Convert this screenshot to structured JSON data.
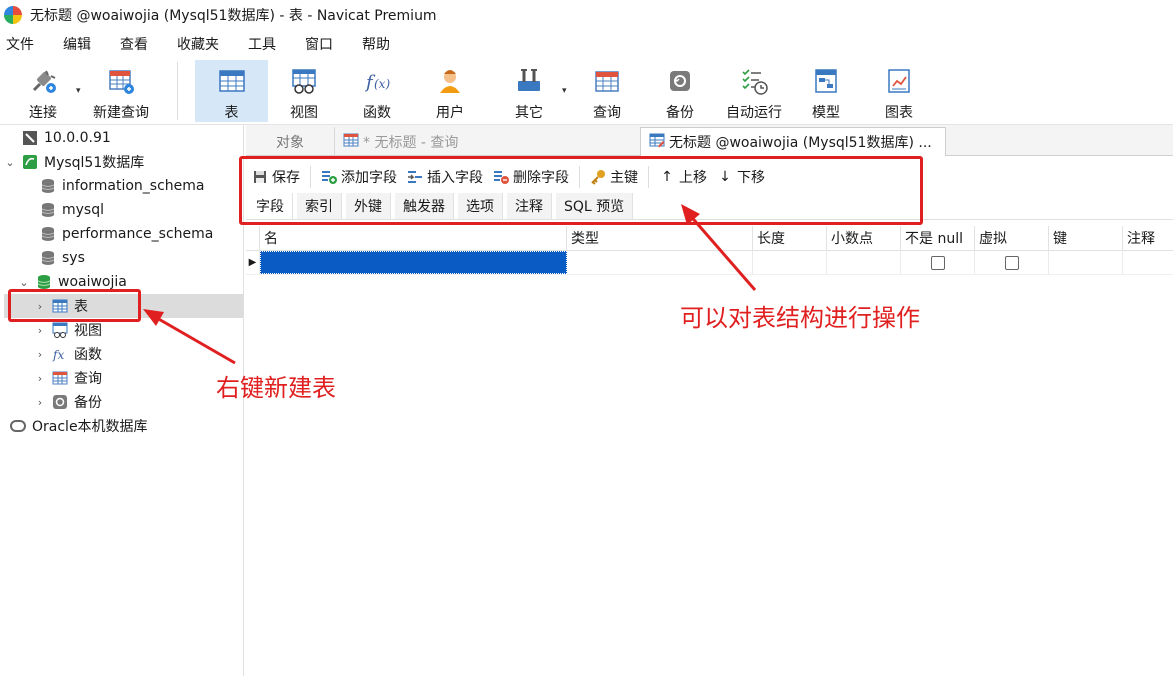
{
  "window": {
    "title": "无标题 @woaiwojia (Mysql51数据库) - 表 - Navicat Premium"
  },
  "menu": [
    "文件",
    "编辑",
    "查看",
    "收藏夹",
    "工具",
    "窗口",
    "帮助"
  ],
  "toolbar": {
    "connect": "连接",
    "new_query": "新建查询",
    "table": "表",
    "view": "视图",
    "function": "函数",
    "user": "用户",
    "other": "其它",
    "query": "查询",
    "backup": "备份",
    "automation": "自动运行",
    "model": "模型",
    "chart": "图表"
  },
  "sidebar": {
    "items": [
      {
        "label": "10.0.0.91"
      },
      {
        "label": "Mysql51数据库"
      },
      {
        "label": "information_schema"
      },
      {
        "label": "mysql"
      },
      {
        "label": "performance_schema"
      },
      {
        "label": "sys"
      },
      {
        "label": "woaiwojia"
      },
      {
        "label": "表"
      },
      {
        "label": "视图"
      },
      {
        "label": "函数"
      },
      {
        "label": "查询"
      },
      {
        "label": "备份"
      },
      {
        "label": "Oracle本机数据库"
      }
    ]
  },
  "tabs": {
    "objects": "对象",
    "query_tab": "* 无标题 - 查询",
    "table_tab": "无标题 @woaiwojia (Mysql51数据库) ..."
  },
  "editor_toolbar": {
    "save": "保存",
    "add_field": "添加字段",
    "insert_field": "插入字段",
    "delete_field": "删除字段",
    "primary_key": "主键",
    "move_up": "上移",
    "move_down": "下移"
  },
  "subtabs": [
    "字段",
    "索引",
    "外键",
    "触发器",
    "选项",
    "注释",
    "SQL 预览"
  ],
  "grid": {
    "columns": [
      "名",
      "类型",
      "长度",
      "小数点",
      "不是 null",
      "虚拟",
      "键",
      "注释"
    ]
  },
  "annotations": {
    "right_click": "右键新建表",
    "operate": "可以对表结构进行操作"
  },
  "colors": {
    "annotation": "#e02020",
    "selection": "#0a5bc4",
    "active_tool": "#d6e8f8"
  }
}
